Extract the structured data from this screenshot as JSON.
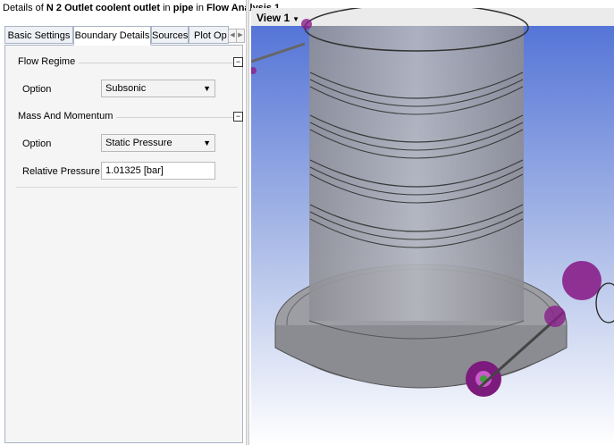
{
  "header": {
    "prefix": "Details of",
    "object": "N 2 Outlet coolent outlet",
    "in1": "in",
    "domain": "pipe",
    "in2": "in",
    "analysis": "Flow Analysis 1"
  },
  "tabs": [
    {
      "label": "Basic Settings"
    },
    {
      "label": "Boundary Details"
    },
    {
      "label": "Sources"
    },
    {
      "label": "Plot Op"
    }
  ],
  "flow_regime": {
    "label": "Flow Regime",
    "option_label": "Option",
    "option_value": "Subsonic"
  },
  "mass_momentum": {
    "label": "Mass And Momentum",
    "option_label": "Option",
    "option_value": "Static Pressure",
    "pressure_label": "Relative Pressure",
    "pressure_value": "1.01325 [bar]"
  },
  "viewport": {
    "title": "View 1"
  },
  "colors": {
    "background_top": "#4e6fd6",
    "background_bottom": "#ffffff",
    "marker": "#8a1f8a",
    "geometry": "#9a9a9a"
  },
  "icons": {
    "collapse": "minus-box-icon",
    "dropdown": "chevron-down-icon",
    "tab_scroll_left": "chevron-left-icon",
    "tab_scroll_right": "chevron-right-icon"
  }
}
